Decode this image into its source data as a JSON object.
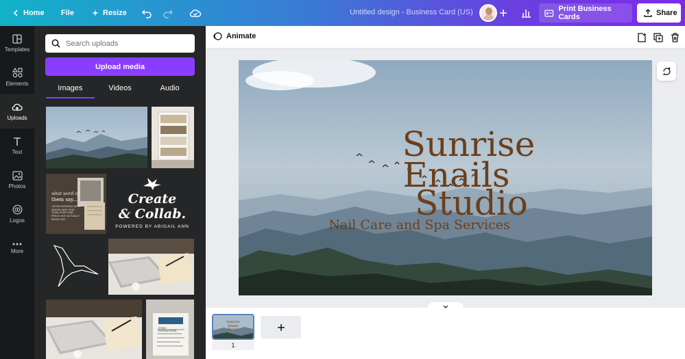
{
  "topbar": {
    "home_label": "Home",
    "file_label": "File",
    "resize_label": "Resize",
    "doc_title": "Untitled design - Business Card (US)",
    "print_label": "Print Business Cards",
    "share_label": "Share",
    "gradient_start": "#12b2c9",
    "gradient_end": "#7d2ae8"
  },
  "rail": {
    "items": [
      {
        "label": "Templates",
        "icon": "templates-icon"
      },
      {
        "label": "Elements",
        "icon": "elements-icon"
      },
      {
        "label": "Uploads",
        "icon": "upload-cloud-icon"
      },
      {
        "label": "Text",
        "icon": "text-icon"
      },
      {
        "label": "Photos",
        "icon": "photo-icon"
      },
      {
        "label": "Logos",
        "icon": "logo-icon"
      },
      {
        "label": "More",
        "icon": "more-dots-icon"
      }
    ],
    "active": "Uploads"
  },
  "panel": {
    "search_placeholder": "Search uploads",
    "upload_button": "Upload media",
    "upload_button_color": "#8b3dff",
    "tabs": [
      "Images",
      "Videos",
      "Audio"
    ],
    "active_tab": "Images",
    "collab_text": {
      "line1": "Create",
      "line2": "& Collab.",
      "line3": "POWERED BY ABIGAIL ANN"
    },
    "laptop_card_text": {
      "line1": "what word of",
      "line2": "them say...",
      "line3": "\"AFTER WORKING WITH ABIGAIL AND YOUR TEAM, EVERYONE FEELS LIKE I ACTUALLY KNOW YOU\""
    },
    "note_card_text": "STRAY DISTRACTIONS..."
  },
  "toolbar": {
    "animate_label": "Animate"
  },
  "design": {
    "title_line1": "Sunrise",
    "title_line2": "Enails",
    "title_line3": "Studio",
    "subtitle": "Nail Care and Spa Services",
    "text_color": "#6b3f1c"
  },
  "pages": {
    "current_page": "1",
    "thumb_text": "Sunrise Enails Studio"
  }
}
